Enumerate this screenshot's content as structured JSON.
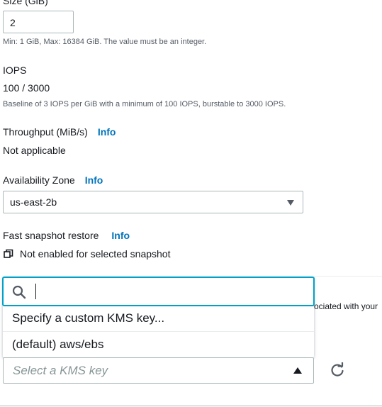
{
  "size": {
    "label": "Size (GiB)",
    "value": "2",
    "hint": "Min: 1 GiB, Max: 16384 GiB. The value must be an integer."
  },
  "iops": {
    "label": "IOPS",
    "value": "100 / 3000",
    "hint": "Baseline of 3 IOPS per GiB with a minimum of 100 IOPS, burstable to 3000 IOPS."
  },
  "throughput": {
    "label": "Throughput (MiB/s)",
    "info": "Info",
    "value": "Not applicable"
  },
  "availability_zone": {
    "label": "Availability Zone",
    "info": "Info",
    "selected": "us-east-2b"
  },
  "fast_snapshot_restore": {
    "label": "Fast snapshot restore",
    "info": "Info",
    "status": "Not enabled for selected snapshot"
  },
  "kms": {
    "search_value": "",
    "options": [
      "Specify a custom KMS key...",
      "(default) aws/ebs"
    ],
    "placeholder": "Select a KMS key",
    "behind_text": "ociated with your"
  },
  "icons": {
    "search": "search-icon",
    "refresh": "refresh-icon",
    "copy": "copy-icon",
    "dropdown": "caret-down-icon"
  },
  "colors": {
    "link": "#0073bb",
    "focus": "#00a1c9",
    "text": "#16191f",
    "secondary_text": "#545b64"
  }
}
